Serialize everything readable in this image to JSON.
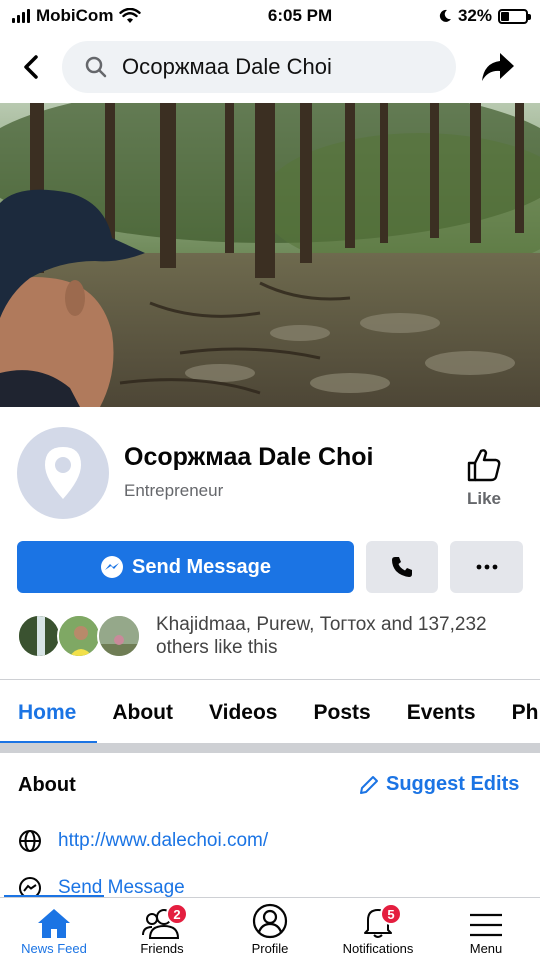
{
  "status_bar": {
    "carrier": "MobiCom",
    "time": "6:05 PM",
    "battery_percent": "32%",
    "battery_level": 0.32,
    "icons": [
      "signal-icon",
      "wifi-icon",
      "moon-icon",
      "battery-icon"
    ]
  },
  "header": {
    "search_text": "Осоржмаа Dale Choi",
    "icons": [
      "back-arrow-icon",
      "search-icon",
      "share-icon"
    ]
  },
  "profile": {
    "name": "Осоржмаа Dale Choi",
    "category": "Entrepreneur",
    "like_label": "Like"
  },
  "actions": {
    "send_message": "Send Message",
    "icons": [
      "messenger-icon",
      "phone-icon",
      "more-icon"
    ]
  },
  "likes": {
    "text_line1": "Khajidmaa, Purew, Тогтох and 137,232",
    "text_line2": "others like this"
  },
  "tabs": [
    {
      "label": "Home",
      "active": true
    },
    {
      "label": "About"
    },
    {
      "label": "Videos"
    },
    {
      "label": "Posts"
    },
    {
      "label": "Events"
    },
    {
      "label": "Ph"
    }
  ],
  "about": {
    "title": "About",
    "suggest_edits": "Suggest Edits",
    "website": "http://www.dalechoi.com/",
    "send_message": "Send Message"
  },
  "bottom_nav": [
    {
      "label": "News Feed",
      "icon": "home-icon",
      "active": true
    },
    {
      "label": "Friends",
      "icon": "friends-icon",
      "badge": "2"
    },
    {
      "label": "Profile",
      "icon": "profile-icon"
    },
    {
      "label": "Notifications",
      "icon": "bell-icon",
      "badge": "5"
    },
    {
      "label": "Menu",
      "icon": "hamburger-icon"
    }
  ],
  "colors": {
    "accent": "#1b74e4",
    "badge": "#e41e3f",
    "secondary_text": "#65676b"
  }
}
